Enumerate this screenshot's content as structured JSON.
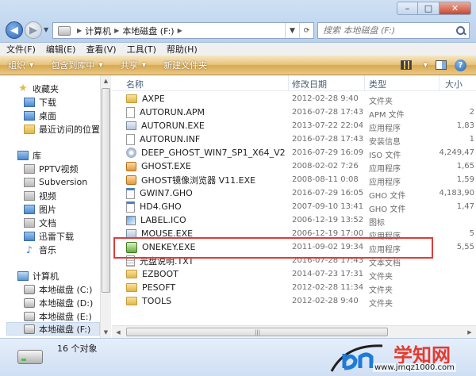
{
  "window": {
    "minimize_glyph": "–",
    "maximize_glyph": "□",
    "close_glyph": "✕"
  },
  "address": {
    "segments": [
      "计算机",
      "本地磁盘 (F:)"
    ]
  },
  "search": {
    "placeholder": "搜索 本地磁盘 (F:)"
  },
  "menu": [
    "文件(F)",
    "编辑(E)",
    "查看(V)",
    "工具(T)",
    "帮助(H)"
  ],
  "toolbar": {
    "organize": "组织",
    "include_in_library": "包含到库中",
    "share": "共享",
    "new_folder": "新建文件夹"
  },
  "nav": {
    "favorites": "收藏夹",
    "downloads": "下载",
    "desktop": "桌面",
    "recent": "最近访问的位置",
    "libraries": "库",
    "pptv": "PPTV视频",
    "subversion": "Subversion",
    "videos": "视频",
    "pictures": "图片",
    "documents": "文档",
    "xunlei": "迅雷下载",
    "music": "音乐",
    "computer": "计算机",
    "drive_c": "本地磁盘 (C:)",
    "drive_d": "本地磁盘 (D:)",
    "drive_e": "本地磁盘 (E:)",
    "drive_f": "本地磁盘 (F:)"
  },
  "columns": {
    "name": "名称",
    "date": "修改日期",
    "type": "类型",
    "size": "大小"
  },
  "files": [
    {
      "name": "AXPE",
      "date": "2012-02-28 9:40",
      "type": "文件夹",
      "size": "",
      "icon": "folder"
    },
    {
      "name": "AUTORUN.APM",
      "date": "2016-07-28 17:43",
      "type": "APM 文件",
      "size": "2",
      "icon": "doc"
    },
    {
      "name": "AUTORUN.EXE",
      "date": "2013-07-22 22:04",
      "type": "应用程序",
      "size": "1,83",
      "icon": "exe"
    },
    {
      "name": "AUTORUN.INF",
      "date": "2016-07-28 17:43",
      "type": "安装信息",
      "size": "1",
      "icon": "doc"
    },
    {
      "name": "DEEP_GHOST_WIN7_SP1_X64_V2016_08.iso",
      "date": "2016-07-29 16:09",
      "type": "ISO 文件",
      "size": "4,249,47",
      "icon": "iso"
    },
    {
      "name": "GHOST.EXE",
      "date": "2008-02-02 7:26",
      "type": "应用程序",
      "size": "1,65",
      "icon": "ghost"
    },
    {
      "name": "GHOST镜像浏览器 V11.EXE",
      "date": "2008-08-11 0:08",
      "type": "应用程序",
      "size": "1,59",
      "icon": "ghost"
    },
    {
      "name": "GWIN7.GHO",
      "date": "2016-07-29 16:05",
      "type": "GHO 文件",
      "size": "4,183,90",
      "icon": "gho"
    },
    {
      "name": "HD4.GHO",
      "date": "2007-09-10 13:41",
      "type": "GHO 文件",
      "size": "1,47",
      "icon": "gho"
    },
    {
      "name": "LABEL.ICO",
      "date": "2006-12-19 13:52",
      "type": "图标",
      "size": "",
      "icon": "ico"
    },
    {
      "name": "MOUSE.EXE",
      "date": "2006-12-19 17:00",
      "type": "应用程序",
      "size": "5",
      "icon": "exe"
    },
    {
      "name": "ONEKEY.EXE",
      "date": "2011-09-02 19:34",
      "type": "应用程序",
      "size": "5,55",
      "icon": "onekey"
    },
    {
      "name": "光盘说明.TXT",
      "date": "2016-07-28 17:43",
      "type": "文本文档",
      "size": "",
      "icon": "txt"
    },
    {
      "name": "EZBOOT",
      "date": "2014-07-23 17:31",
      "type": "文件夹",
      "size": "",
      "icon": "folder"
    },
    {
      "name": "PESOFT",
      "date": "2012-02-28 11:34",
      "type": "文件夹",
      "size": "",
      "icon": "folder"
    },
    {
      "name": "TOOLS",
      "date": "2012-02-28 9:40",
      "type": "文件夹",
      "size": "",
      "icon": "folder"
    }
  ],
  "status": {
    "count": "16 个对象"
  },
  "watermark": {
    "name": "学知网",
    "url": "www.jmqz1000.com"
  }
}
